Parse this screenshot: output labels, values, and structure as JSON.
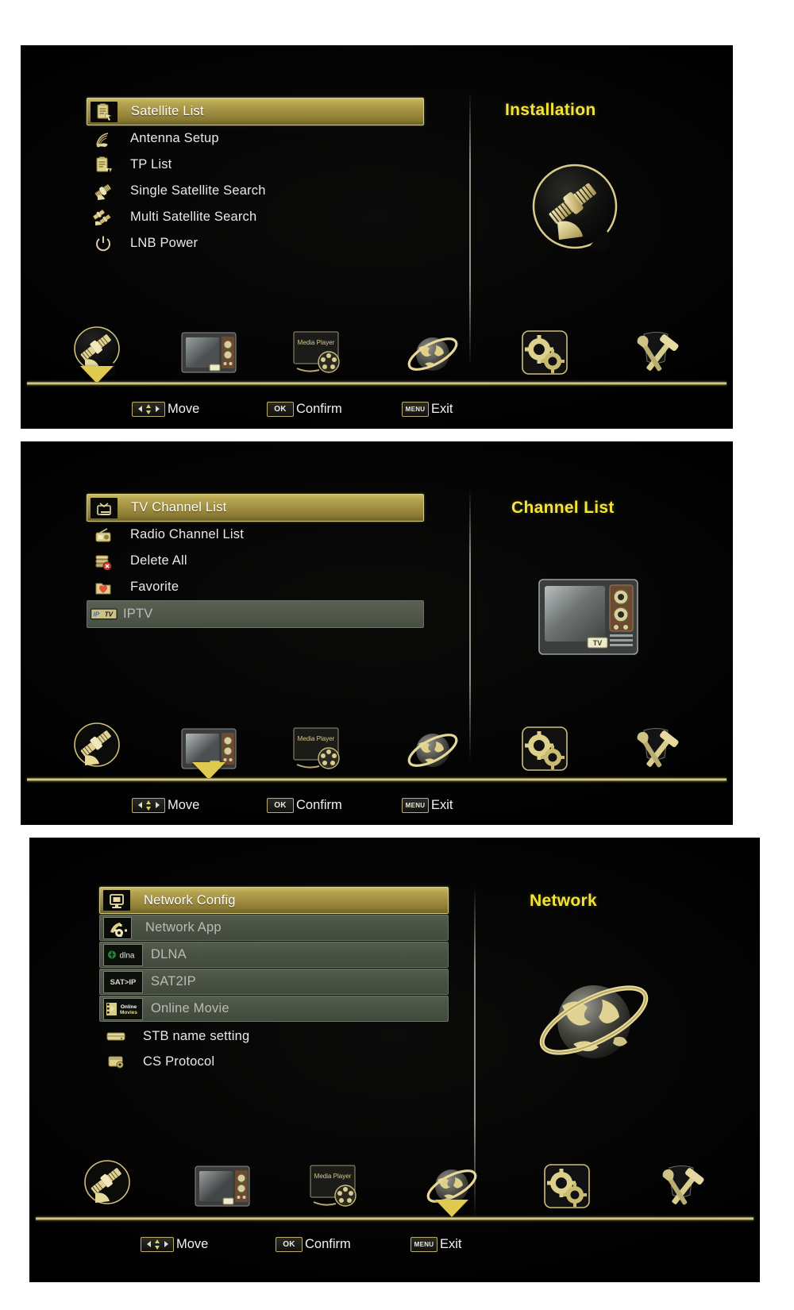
{
  "panels": [
    {
      "title": "Installation",
      "hero_icon": "satellite-dish-graphic",
      "menu": [
        {
          "label": "Satellite List",
          "icon": "satellite-list-icon",
          "state": "selected"
        },
        {
          "label": "Antenna Setup",
          "icon": "antenna-setup-icon",
          "state": "normal"
        },
        {
          "label": "TP List",
          "icon": "tp-list-icon",
          "state": "normal"
        },
        {
          "label": "Single Satellite Search",
          "icon": "single-satellite-icon",
          "state": "normal"
        },
        {
          "label": "Multi Satellite Search",
          "icon": "multi-satellite-icon",
          "state": "normal"
        },
        {
          "label": "LNB Power",
          "icon": "power-icon",
          "state": "normal"
        }
      ],
      "nav_selected_index": 0
    },
    {
      "title": "Channel List",
      "hero_icon": "tv-set-graphic",
      "hero_badge": "TV",
      "menu": [
        {
          "label": "TV Channel List",
          "icon": "tv-channel-icon",
          "state": "selected"
        },
        {
          "label": "Radio Channel List",
          "icon": "radio-icon",
          "state": "normal"
        },
        {
          "label": "Delete All",
          "icon": "delete-all-icon",
          "state": "normal"
        },
        {
          "label": "Favorite",
          "icon": "favorite-icon",
          "state": "normal"
        },
        {
          "label": "IPTV",
          "icon": "iptv-badge-icon",
          "state": "disabled"
        }
      ],
      "nav_selected_index": 1
    },
    {
      "title": "Network",
      "hero_icon": "globe-network-graphic",
      "menu": [
        {
          "label": "Network Config",
          "icon": "network-config-icon",
          "state": "selected"
        },
        {
          "label": "Network App",
          "icon": "network-app-icon",
          "state": "disabled"
        },
        {
          "label": "DLNA",
          "icon": "dlna-badge-icon",
          "state": "disabled"
        },
        {
          "label": "SAT2IP",
          "icon": "sat2ip-badge-icon",
          "state": "disabled"
        },
        {
          "label": "Online Movie",
          "icon": "online-movie-icon",
          "state": "disabled"
        },
        {
          "label": "STB name setting",
          "icon": "stb-name-icon",
          "state": "normal"
        },
        {
          "label": "CS Protocol",
          "icon": "cs-protocol-icon",
          "state": "normal"
        }
      ],
      "nav_selected_index": 3
    }
  ],
  "nav_items": [
    {
      "name": "installation",
      "icon": "satellite-nav-icon"
    },
    {
      "name": "channel-list",
      "icon": "tv-nav-icon"
    },
    {
      "name": "media-player",
      "icon": "media-player-nav-icon",
      "caption": "Media Player"
    },
    {
      "name": "network",
      "icon": "globe-nav-icon"
    },
    {
      "name": "settings",
      "icon": "gears-nav-icon"
    },
    {
      "name": "tools",
      "icon": "tools-nav-icon"
    }
  ],
  "hints": [
    {
      "key": "dpad",
      "label": "Move"
    },
    {
      "key": "OK",
      "label": "Confirm"
    },
    {
      "key": "MENU",
      "label": "Exit"
    }
  ],
  "badges": {
    "iptv": "IPTV",
    "dlna": "dlna",
    "sat2ip": "SAT>IP",
    "online_movie_top": "Online",
    "online_movie_bottom": "Movies"
  },
  "colors": {
    "accent_gold": "#c9bb63",
    "title_yellow": "#f2e43a",
    "disabled_row": "#4a5244",
    "text_primary": "#e9e9e9",
    "background": "#050505"
  }
}
